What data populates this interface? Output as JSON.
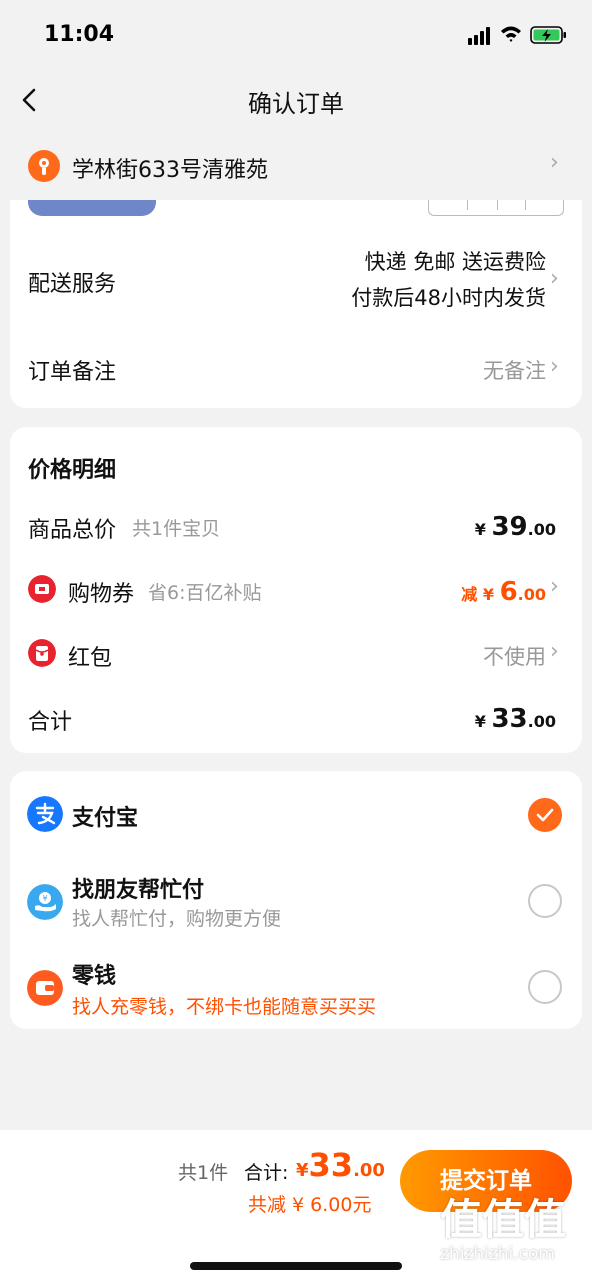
{
  "status": {
    "time": "11:04"
  },
  "header": {
    "title": "确认订单"
  },
  "address": {
    "text": "学林街633号清雅苑"
  },
  "delivery": {
    "label": "配送服务",
    "line1": "快递 免邮 送运费险",
    "line2": "付款后48小时内发货"
  },
  "remark": {
    "label": "订单备注",
    "value": "无备注"
  },
  "price_detail": {
    "title": "价格明细",
    "goods_total": {
      "label": "商品总价",
      "sub": "共1件宝贝",
      "currency": "¥",
      "int": "39",
      "dec": ".00"
    },
    "coupon": {
      "label": "购物券",
      "sub": "省6:百亿补贴",
      "prefix": "减",
      "currency": "¥",
      "int": "6",
      "dec": ".00"
    },
    "redpacket": {
      "label": "红包",
      "value": "不使用"
    },
    "total": {
      "label": "合计",
      "currency": "¥",
      "int": "33",
      "dec": ".00"
    }
  },
  "payment": {
    "options": [
      {
        "label": "支付宝",
        "sub": "",
        "checked": true
      },
      {
        "label": "找朋友帮忙付",
        "sub": "找人帮忙付，购物更方便",
        "checked": false
      },
      {
        "label": "零钱",
        "sub": "找人充零钱，不绑卡也能随意买买买",
        "checked": false
      }
    ]
  },
  "bottom": {
    "count": "共1件",
    "total_label": "合计:",
    "currency": "¥",
    "total_int": "33",
    "total_dec": ".00",
    "discount": "共减 ¥ 6.00元",
    "submit": "提交订单"
  },
  "watermark": {
    "glyphs": "值值值",
    "url": "zhizhizhi.com"
  },
  "colors": {
    "accent": "#ff5000",
    "page_bg": "#f2f2f2",
    "alipay": "#1677ff",
    "coupon_red": "#e8222e"
  }
}
